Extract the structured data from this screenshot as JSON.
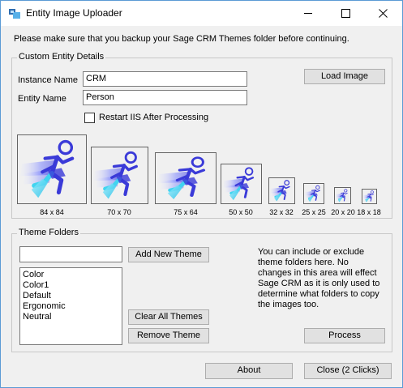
{
  "window": {
    "title": "Entity Image Uploader"
  },
  "notice": "Please make sure that you backup your Sage CRM Themes folder before continuing.",
  "custom": {
    "legend": "Custom Entity Details",
    "instance_label": "Instance Name",
    "instance_value": "CRM",
    "entity_label": "Entity Name",
    "entity_value": "Person",
    "load_button": "Load Image",
    "restart_label": "Restart IIS After Processing",
    "restart_checked": false
  },
  "thumbnails": [
    {
      "label": "84 x 84"
    },
    {
      "label": "70 x 70"
    },
    {
      "label": "75 x 64"
    },
    {
      "label": "50 x 50"
    },
    {
      "label": "32 x 32"
    },
    {
      "label": "25 x 25"
    },
    {
      "label": "20 x 20"
    },
    {
      "label": "18 x 18"
    }
  ],
  "themes": {
    "legend": "Theme Folders",
    "new_theme_value": "",
    "add_button": "Add New Theme",
    "list": [
      "Color",
      "Color1",
      "Default",
      "Ergonomic",
      "Neutral"
    ],
    "clear_button": "Clear All Themes",
    "remove_button": "Remove Theme",
    "info": "You can include or exclude theme folders here. No changes in this area will effect Sage CRM as it is only used to determine what folders to copy the images too.",
    "process_button": "Process"
  },
  "footer": {
    "about_button": "About",
    "close_button": "Close (2 Clicks)"
  },
  "icons": {
    "app": "app-window-icon",
    "minimize": "minimize-icon",
    "maximize": "maximize-icon",
    "close": "close-icon",
    "runner": "running-person-icon"
  },
  "colors": {
    "window_border": "#5b9bd5",
    "runner_blue": "#3a3ad8",
    "runner_cyan": "#41d4f0",
    "runner_light": "#dfe2ff"
  }
}
